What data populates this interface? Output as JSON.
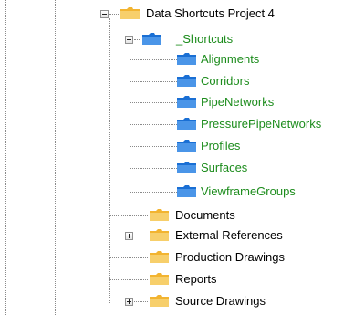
{
  "tree": {
    "project": {
      "label": "Data Shortcuts Project 4",
      "expanded": true,
      "icon": "folder-yellow-icon"
    },
    "shortcuts": {
      "label": "_Shortcuts",
      "expanded": true,
      "icon": "folder-blue-icon",
      "color": "#1c8c1c",
      "children": [
        {
          "label": "Alignments",
          "icon": "folder-blue-icon"
        },
        {
          "label": "Corridors",
          "icon": "folder-blue-icon"
        },
        {
          "label": "PipeNetworks",
          "icon": "folder-blue-icon"
        },
        {
          "label": "PressurePipeNetworks",
          "icon": "folder-blue-icon"
        },
        {
          "label": "Profiles",
          "icon": "folder-blue-icon"
        },
        {
          "label": "Surfaces",
          "icon": "folder-blue-icon"
        },
        {
          "label": "ViewframeGroups",
          "icon": "folder-blue-icon"
        }
      ]
    },
    "folders": [
      {
        "label": "Documents",
        "expandable": false,
        "icon": "folder-yellow-icon"
      },
      {
        "label": "External References",
        "expandable": true,
        "icon": "folder-yellow-icon"
      },
      {
        "label": "Production Drawings",
        "expandable": false,
        "icon": "folder-yellow-icon"
      },
      {
        "label": "Reports",
        "expandable": false,
        "icon": "folder-yellow-icon"
      },
      {
        "label": "Source Drawings",
        "expandable": true,
        "icon": "folder-yellow-icon"
      }
    ]
  },
  "colors": {
    "folder_yellow": "#f2b431",
    "folder_yellow_light": "#f7cf6b",
    "folder_blue": "#1a6fd4",
    "folder_blue_light": "#4a95e8",
    "shortcut_text": "#1c8c1c",
    "dotted_line": "#8a8a8a"
  }
}
